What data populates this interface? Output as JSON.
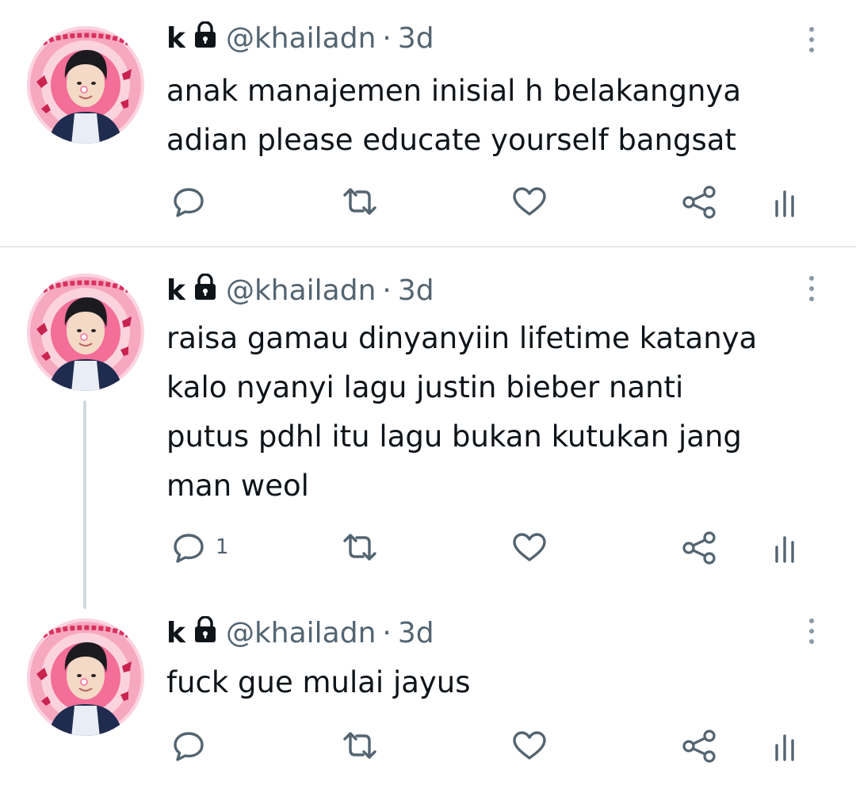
{
  "tweets": [
    {
      "name": "k",
      "handle": "@khailadn",
      "separator": "·",
      "time": "3d",
      "text": "anak manajemen inisial h belakangnya\nadian please educate yourself bangsat",
      "reply_count": "",
      "icons": [
        "reply-icon",
        "retweet-icon",
        "like-icon",
        "share-icon",
        "analytics-icon"
      ]
    },
    {
      "name": "k",
      "handle": "@khailadn",
      "separator": "·",
      "time": "3d",
      "text": "raisa gamau dinyanyiin lifetime katanya\nkalo nyanyi lagu justin bieber nanti\nputus pdhl itu lagu bukan kutukan jang\nman weol",
      "reply_count": "1",
      "icons": [
        "reply-icon",
        "retweet-icon",
        "like-icon",
        "share-icon",
        "analytics-icon"
      ]
    },
    {
      "name": "k",
      "handle": "@khailadn",
      "separator": "·",
      "time": "3d",
      "text": "fuck gue mulai jayus",
      "reply_count": "",
      "icons": [
        "reply-icon",
        "retweet-icon",
        "like-icon",
        "share-icon",
        "analytics-icon"
      ]
    }
  ],
  "colors": {
    "text": "#0f1419",
    "secondary": "#536471",
    "icon": "#536471",
    "thread_line": "#cfd9de",
    "divider": "#e6e9ec",
    "avatar_pink": "#f06a93"
  }
}
